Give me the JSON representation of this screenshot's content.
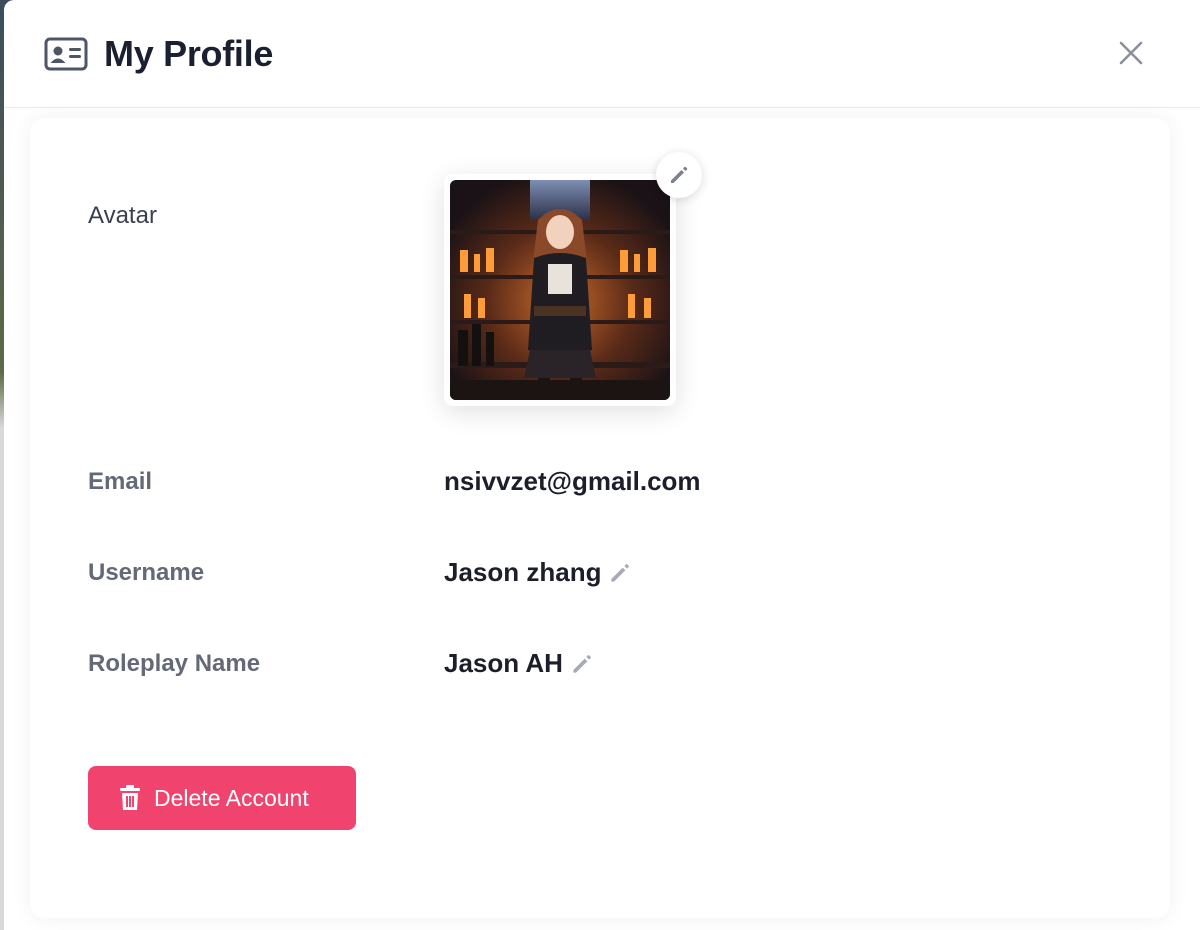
{
  "header": {
    "title": "My Profile",
    "icon": "id-card-icon",
    "close_icon": "close-icon"
  },
  "profile": {
    "avatar_label": "Avatar",
    "avatar_edit_icon": "pencil-icon",
    "email_label": "Email",
    "email_value": "nsivvzet@gmail.com",
    "username_label": "Username",
    "username_value": "Jason zhang",
    "roleplay_label": "Roleplay Name",
    "roleplay_value": "Jason AH"
  },
  "actions": {
    "delete_label": "Delete Account",
    "delete_icon": "trash-icon",
    "delete_color": "#f0436e"
  }
}
